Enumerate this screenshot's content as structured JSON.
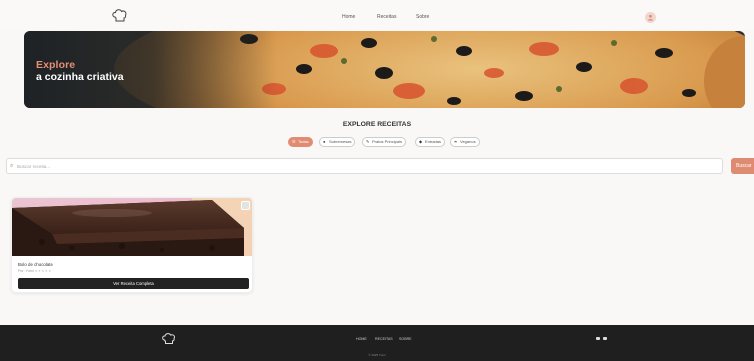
{
  "header": {
    "logo_icon": "chef-hat-icon",
    "nav": [
      {
        "label": "Home"
      },
      {
        "label": "Receitas"
      },
      {
        "label": "Sobre"
      }
    ],
    "avatar_icon": "user-icon"
  },
  "hero": {
    "title": "Explore",
    "subtitle": "a cozinha criativa"
  },
  "explore": {
    "title": "EXPLORE RECEITAS",
    "filters": [
      {
        "label": "Todas",
        "icon": "list-icon",
        "active": true
      },
      {
        "label": "Sobremesas",
        "icon": "cake-icon",
        "active": false
      },
      {
        "label": "Pratos Principais",
        "icon": "utensils-icon",
        "active": false
      },
      {
        "label": "Entradas",
        "icon": "bowl-icon",
        "active": false
      },
      {
        "label": "Veganos",
        "icon": "leaf-icon",
        "active": false
      }
    ]
  },
  "search": {
    "placeholder": "Buscar receita...",
    "button_label": "Buscar"
  },
  "recipes": [
    {
      "title": "Bolo de chocolate",
      "meta": "Por: Yumi",
      "stars": "★★★★★",
      "button_label": "Ver Receita Completa"
    }
  ],
  "footer": {
    "nav": [
      {
        "label": "HOME"
      },
      {
        "label": "RECEITAS"
      },
      {
        "label": "SOBRE"
      }
    ],
    "copyright": "© 2025 Yumi"
  },
  "colors": {
    "accent": "#e08c73",
    "dark": "#1f1f1f",
    "button": "#222222"
  }
}
